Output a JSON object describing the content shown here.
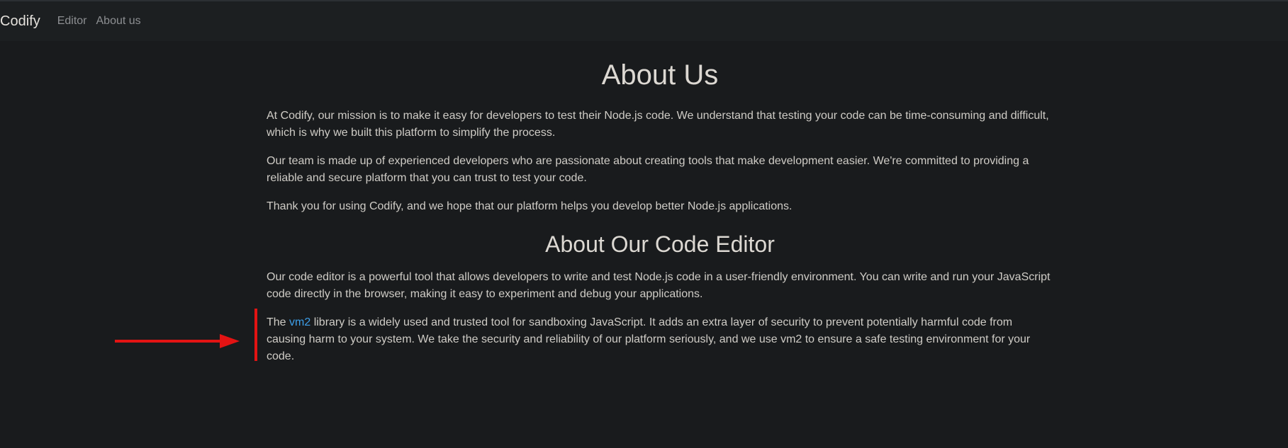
{
  "navbar": {
    "brand": "Codify",
    "links": [
      {
        "label": "Editor"
      },
      {
        "label": "About us"
      }
    ]
  },
  "about": {
    "title": "About Us",
    "paragraphs": [
      "At Codify, our mission is to make it easy for developers to test their Node.js code. We understand that testing your code can be time-consuming and difficult, which is why we built this platform to simplify the process.",
      "Our team is made up of experienced developers who are passionate about creating tools that make development easier. We're committed to providing a reliable and secure platform that you can trust to test your code.",
      "Thank you for using Codify, and we hope that our platform helps you develop better Node.js applications."
    ]
  },
  "editor_section": {
    "title": "About Our Code Editor",
    "paragraph1": "Our code editor is a powerful tool that allows developers to write and test Node.js code in a user-friendly environment. You can write and run your JavaScript code directly in the browser, making it easy to experiment and debug your applications.",
    "vm2_prefix": "The ",
    "vm2_link": "vm2",
    "vm2_suffix": " library is a widely used and trusted tool for sandboxing JavaScript. It adds an extra layer of security to prevent potentially harmful code from causing harm to your system. We take the security and reliability of our platform seriously, and we use vm2 to ensure a safe testing environment for your code."
  },
  "colors": {
    "background": "#191b1d",
    "navbar": "#1c1f21",
    "link": "#3d9ee8",
    "annotation": "#e31313"
  },
  "icons": {
    "annotation_arrow": "arrow-right-icon"
  }
}
